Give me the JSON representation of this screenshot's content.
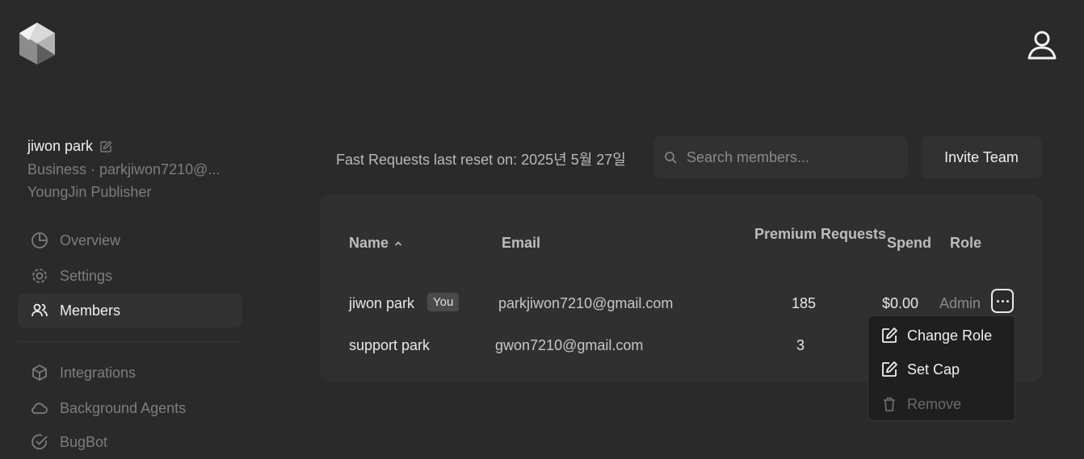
{
  "app": {
    "logo": "cube-logo",
    "account_icon": "user-icon"
  },
  "profile": {
    "name": "jiwon park",
    "plan_line": "Business · parkjiwon7210@...",
    "org": "YoungJin Publisher"
  },
  "sidebar": {
    "items": [
      {
        "label": "Overview",
        "icon": "pie-chart-icon",
        "active": false
      },
      {
        "label": "Settings",
        "icon": "gear-icon",
        "active": false
      },
      {
        "label": "Members",
        "icon": "users-icon",
        "active": true
      },
      {
        "label": "Integrations",
        "icon": "box-icon",
        "active": false
      },
      {
        "label": "Background Agents",
        "icon": "cloud-icon",
        "active": false
      },
      {
        "label": "BugBot",
        "icon": "check-circle-icon",
        "active": false
      }
    ]
  },
  "toolbar": {
    "reset_text": "Fast Requests last reset on: 2025년 5월 27일",
    "search_placeholder": "Search members...",
    "invite_label": "Invite Team"
  },
  "table": {
    "headers": {
      "name": "Name",
      "email": "Email",
      "premium": "Premium Requests",
      "spend": "Spend",
      "role": "Role"
    },
    "rows": [
      {
        "name": "jiwon park",
        "badge": "You",
        "email": "parkjiwon7210@gmail.com",
        "premium": "185",
        "spend": "$0.00",
        "role": "Admin"
      },
      {
        "name": "support park",
        "badge": "",
        "email": "gwon7210@gmail.com",
        "premium": "3",
        "spend": "",
        "role": ""
      }
    ]
  },
  "context_menu": {
    "items": [
      {
        "label": "Change Role",
        "icon": "edit-icon",
        "disabled": false
      },
      {
        "label": "Set Cap",
        "icon": "edit-icon",
        "disabled": false
      },
      {
        "label": "Remove",
        "icon": "trash-icon",
        "disabled": true
      }
    ]
  },
  "colors": {
    "background": "#2a2a2a",
    "card": "#303030",
    "menu": "#1f1f1f"
  }
}
